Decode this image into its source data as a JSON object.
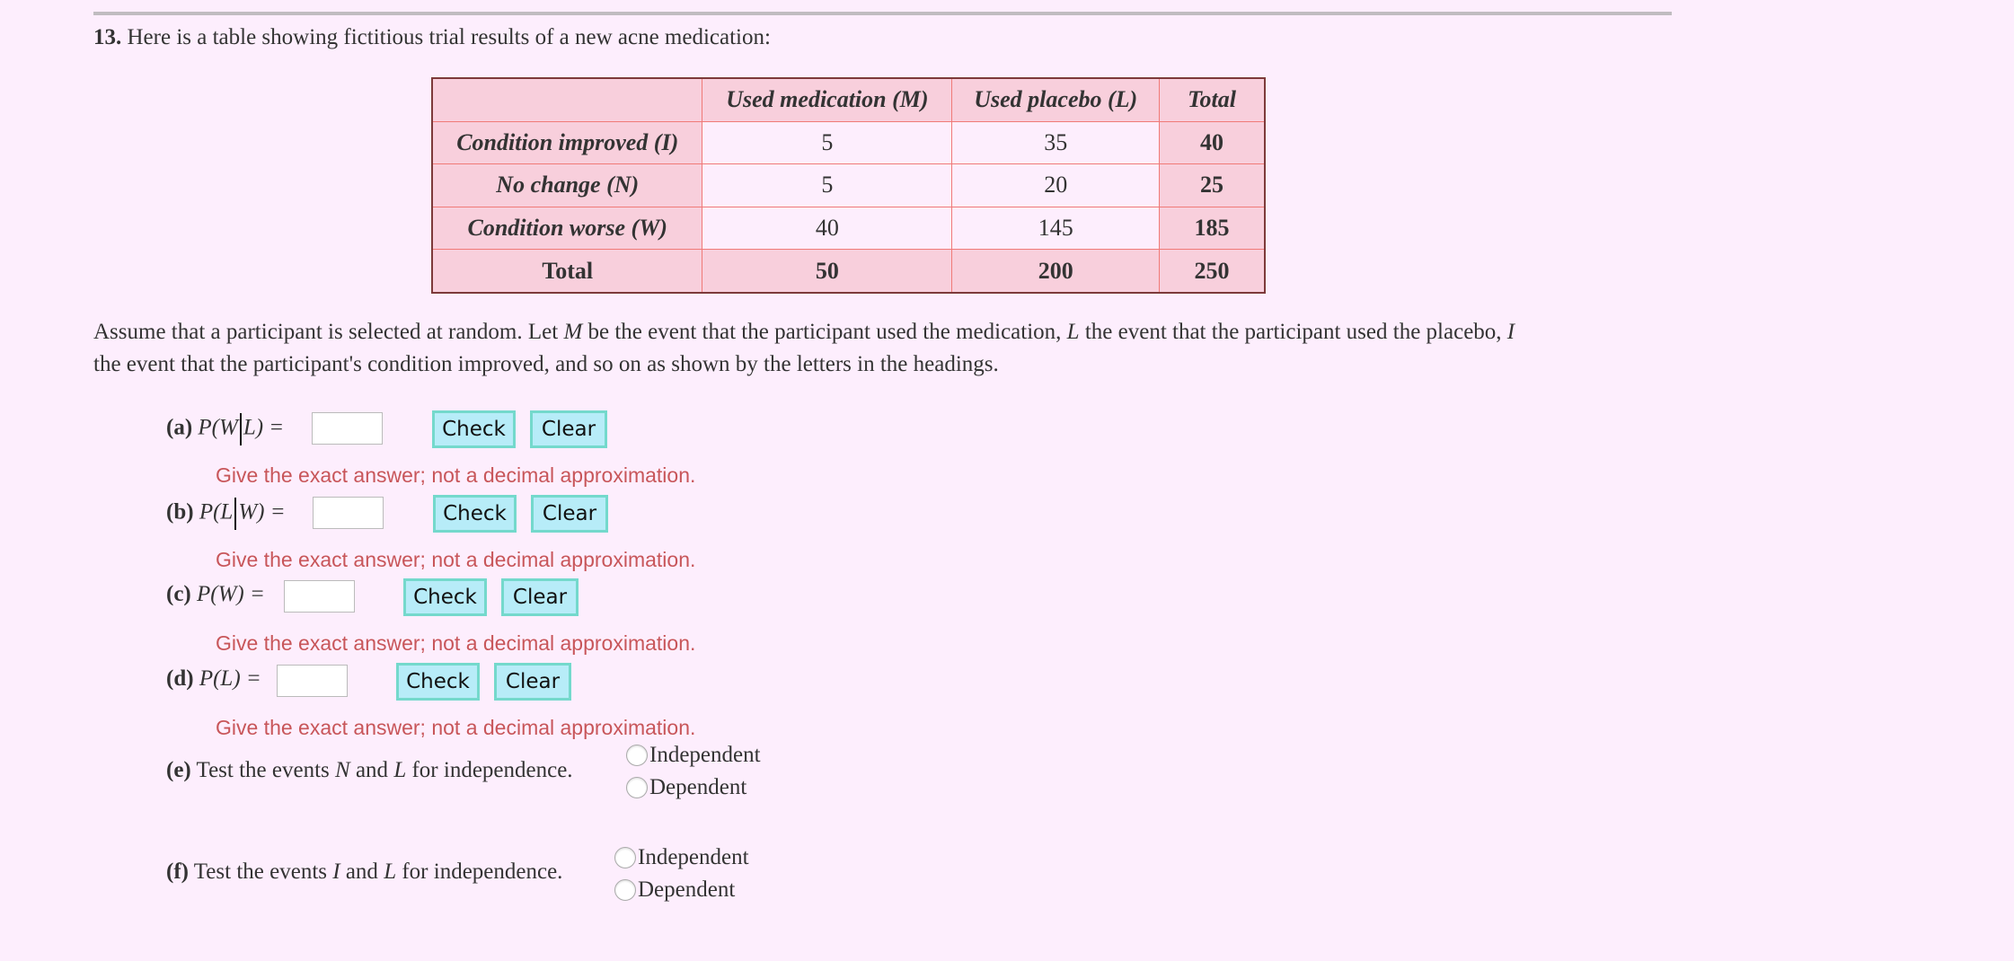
{
  "question": {
    "number": "13.",
    "intro": " Here is a table showing fictitious trial results of a new acne medication:"
  },
  "table": {
    "headers": [
      "",
      "Used medication (M)",
      "Used placebo (L)",
      "Total"
    ],
    "rows": [
      {
        "label": "Condition improved (I)",
        "values": [
          "5",
          "35",
          "40"
        ]
      },
      {
        "label": "No change (N)",
        "values": [
          "5",
          "20",
          "25"
        ]
      },
      {
        "label": "Condition worse (W)",
        "values": [
          "40",
          "145",
          "185"
        ]
      }
    ],
    "total_row": {
      "label": "Total",
      "values": [
        "50",
        "200",
        "250"
      ]
    }
  },
  "paragraph": {
    "p1": "Assume that a participant is selected at random. Let ",
    "M": "M",
    "p2": " be the event that the participant used the medication, ",
    "L": "L",
    "p3": " the event that the participant used the placebo, ",
    "I": "I",
    "p4": " the event that the participant's condition improved, and so on as shown by the letters in the headings."
  },
  "parts": {
    "a": {
      "label": "(a)",
      "expr_pre": "P(W",
      "expr_post": "L) =",
      "answer_value": "",
      "check": "Check",
      "clear": "Clear",
      "hint": "Give the exact answer; not a decimal approximation."
    },
    "b": {
      "label": "(b)",
      "expr_pre": "P(L",
      "expr_post": "W) =",
      "answer_value": "",
      "check": "Check",
      "clear": "Clear",
      "hint": "Give the exact answer; not a decimal approximation."
    },
    "c": {
      "label": "(c)",
      "expr": "P(W) =",
      "answer_value": "",
      "check": "Check",
      "clear": "Clear",
      "hint": "Give the exact answer; not a decimal approximation."
    },
    "d": {
      "label": "(d)",
      "expr": "P(L) =",
      "answer_value": "",
      "check": "Check",
      "clear": "Clear",
      "hint": "Give the exact answer; not a decimal approximation."
    },
    "e": {
      "label": "(e)",
      "t1": " Test the events ",
      "v1": "N",
      "t2": " and ",
      "v2": "L",
      "t3": " for independence.",
      "options": [
        "Independent",
        "Dependent"
      ]
    },
    "f": {
      "label": "(f)",
      "t1": " Test the events ",
      "v1": "I",
      "t2": " and ",
      "v2": "L",
      "t3": " for independence.",
      "options": [
        "Independent",
        "Dependent"
      ]
    }
  }
}
